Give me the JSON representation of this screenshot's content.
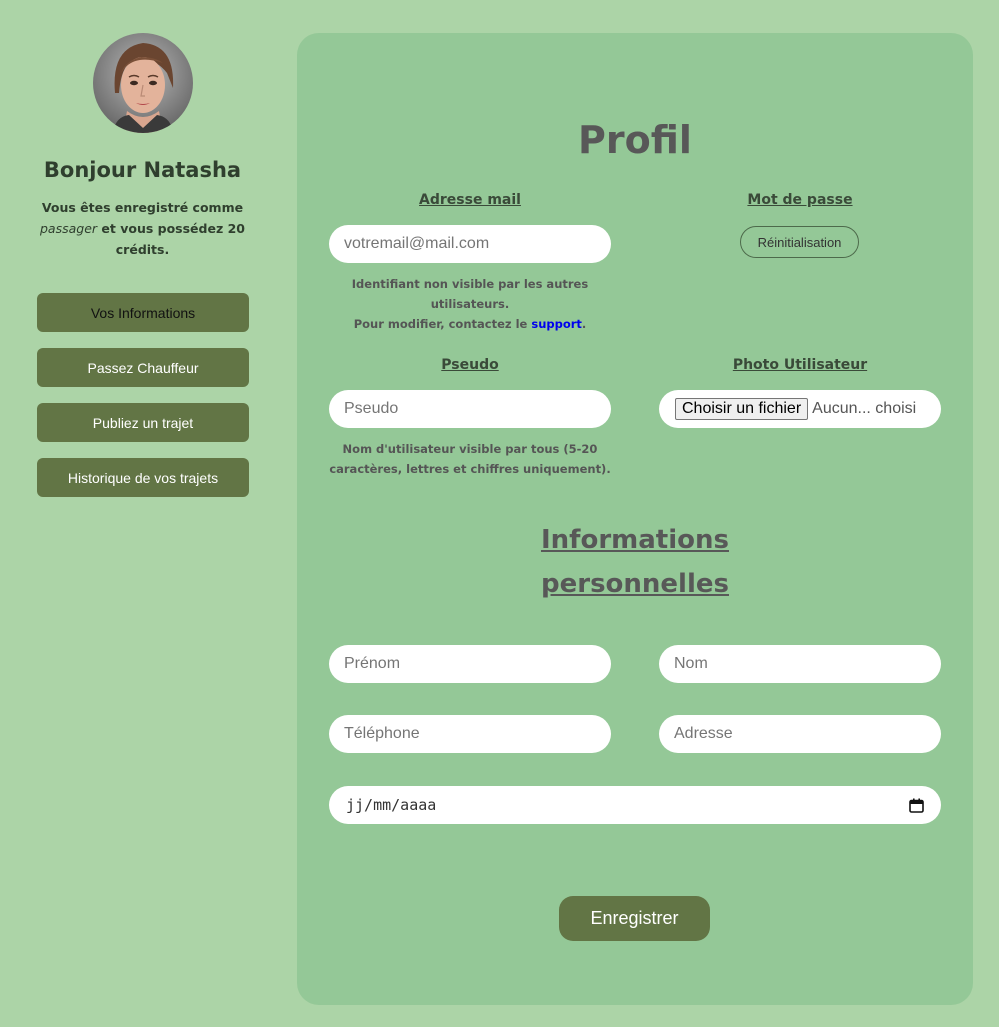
{
  "sidebar": {
    "greeting": "Bonjour Natasha",
    "status_prefix": "Vous êtes enregistré comme ",
    "role": "passager",
    "status_middle": " et vous possédez ",
    "credits": "20 crédits",
    "status_suffix": ".",
    "menu": [
      {
        "label": "Vos Informations"
      },
      {
        "label": "Passez Chauffeur"
      },
      {
        "label": "Publiez un trajet"
      },
      {
        "label": "Historique de vos trajets"
      }
    ]
  },
  "profile": {
    "title": "Profil",
    "email": {
      "label": "Adresse mail",
      "placeholder": "votremail@mail.com",
      "hint_line1": "Identifiant non visible par les autres utilisateurs.",
      "hint_line2_prefix": "Pour modifier, contactez le ",
      "hint_link": "support",
      "hint_line2_suffix": "."
    },
    "password": {
      "label": "Mot de passe",
      "reset_label": "Réinitialisation"
    },
    "pseudo": {
      "label": "Pseudo",
      "placeholder": "Pseudo",
      "hint": "Nom d'utilisateur visible par tous (5-20 caractères, lettres et chiffres uniquement)."
    },
    "photo": {
      "label": "Photo Utilisateur",
      "button_label": "Choisir un fichier",
      "status": "Aucun... choisi"
    }
  },
  "personal": {
    "title_line1": "Informations",
    "title_line2": "personnelles",
    "firstname_placeholder": "Prénom",
    "lastname_placeholder": "Nom",
    "phone_placeholder": "Téléphone",
    "address_placeholder": "Adresse",
    "date_placeholder": "jj/mm/aaaa",
    "submit_label": "Enregistrer"
  }
}
